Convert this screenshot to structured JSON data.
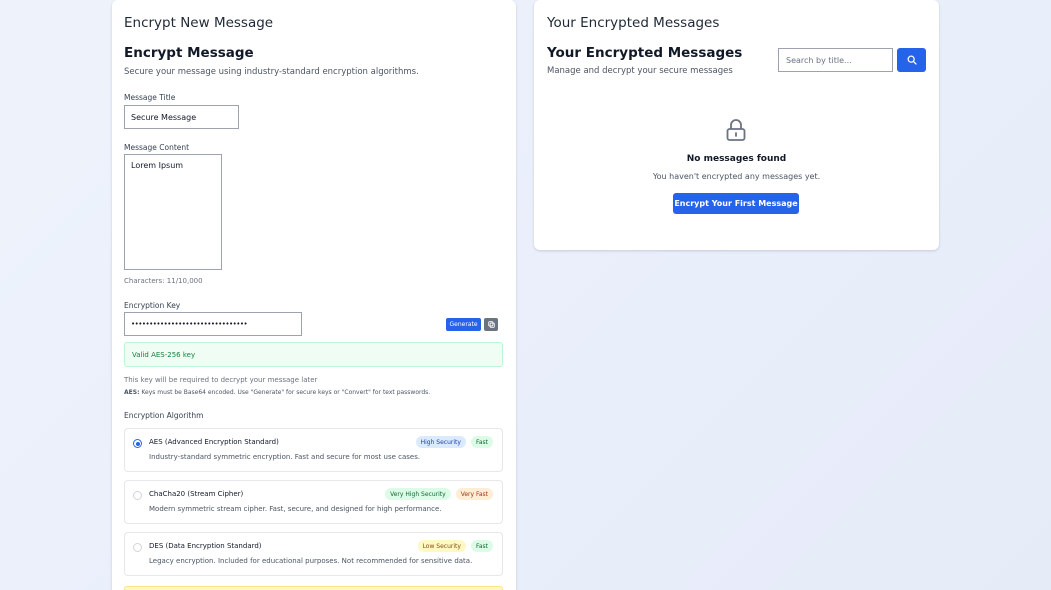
{
  "encrypt_panel": {
    "header": "Encrypt New Message",
    "title": "Encrypt Message",
    "subtitle": "Secure your message using industry-standard encryption algorithms.",
    "message_title": {
      "label": "Message Title",
      "value": "Secure Message"
    },
    "message_content": {
      "label": "Message Content",
      "value": "Lorem Ipsum",
      "char_count": "Characters: 11/10,000"
    },
    "encryption_key": {
      "label": "Encryption Key",
      "value": "••••••••••••••••••••••••••••••••",
      "generate_label": "Generate",
      "copy_icon": "copy-icon",
      "valid_message": "Valid AES-256 key",
      "hint": "This key will be required to decrypt your message later",
      "note_prefix": "AES:",
      "note_text": "Keys must be Base64 encoded. Use \"Generate\" for secure keys or \"Convert\" for text passwords."
    },
    "algorithm": {
      "label": "Encryption Algorithm",
      "options": [
        {
          "name": "AES (Advanced Encryption Standard)",
          "desc": "Industry-standard symmetric encryption. Fast and secure for most use cases.",
          "badges": [
            "High Security",
            "Fast"
          ],
          "selected": true
        },
        {
          "name": "ChaCha20 (Stream Cipher)",
          "desc": "Modern symmetric stream cipher. Fast, secure, and designed for high performance.",
          "badges": [
            "Very High Security",
            "Very Fast"
          ],
          "selected": false
        },
        {
          "name": "DES (Data Encryption Standard)",
          "desc": "Legacy encryption. Included for educational purposes. Not recommended for sensitive data.",
          "badges": [
            "Low Security",
            "Fast"
          ],
          "selected": false
        }
      ]
    }
  },
  "messages_panel": {
    "header": "Your Encrypted Messages",
    "title": "Your Encrypted Messages",
    "subtitle": "Manage and decrypt your secure messages",
    "search_placeholder": "Search by title...",
    "search_icon": "search-icon",
    "lock_icon": "lock-icon",
    "empty_title": "No messages found",
    "empty_desc": "You haven't encrypted any messages yet.",
    "cta_label": "Encrypt Your First Message"
  },
  "colors": {
    "accent": "#2563eb",
    "success_bg": "#f0fdf4",
    "success_text": "#15803d",
    "badge_blue_bg": "#dbeafe",
    "badge_green_bg": "#dcfce7",
    "badge_orange_bg": "#ffedd5",
    "badge_yellow_bg": "#fef9c3"
  }
}
